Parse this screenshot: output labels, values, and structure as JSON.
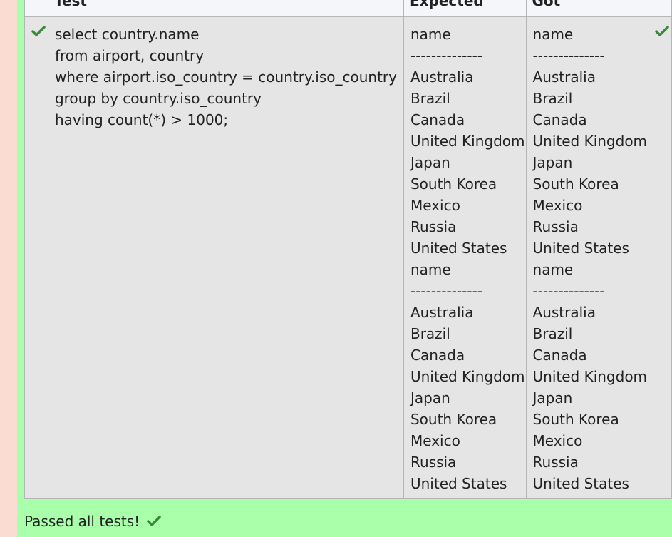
{
  "table": {
    "headers": {
      "check": "",
      "test": "Test",
      "expected": "Expected",
      "got": "Got",
      "result": ""
    },
    "row": {
      "test_lines": [
        "select country.name",
        "from airport, country",
        "where airport.iso_country = country.iso_country",
        "group by country.iso_country",
        "having count(*) > 1000;"
      ],
      "expected_lines": [
        "name",
        "--------------",
        "Australia",
        "Brazil",
        "Canada",
        "United Kingdom",
        "Japan",
        "South Korea",
        "Mexico",
        "Russia",
        "United States",
        "name",
        "--------------",
        "Australia",
        "Brazil",
        "Canada",
        "United Kingdom",
        "Japan",
        "South Korea",
        "Mexico",
        "Russia",
        "United States"
      ],
      "got_lines": [
        "name",
        "--------------",
        "Australia",
        "Brazil",
        "Canada",
        "United Kingdom",
        "Japan",
        "South Korea",
        "Mexico",
        "Russia",
        "United States",
        "name",
        "--------------",
        "Australia",
        "Brazil",
        "Canada",
        "United Kingdom",
        "Japan",
        "South Korea",
        "Mexico",
        "Russia",
        "United States"
      ]
    }
  },
  "footer": {
    "message": "Passed all tests!"
  },
  "colors": {
    "pass_background": "#aaffaa",
    "fail_strip": "#fadcd2",
    "check_green": "#3b8a3b"
  },
  "icons": {
    "row_status": "check-icon",
    "row_result": "check-icon",
    "footer": "check-icon"
  }
}
